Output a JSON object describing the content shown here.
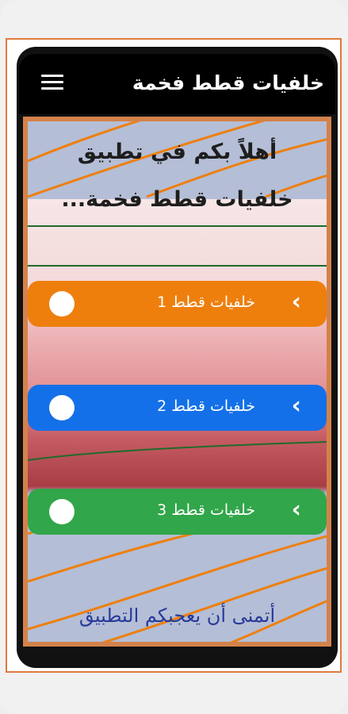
{
  "app_bar": {
    "title": "خلفيات قطط فخمة",
    "menu_icon": "hamburger-menu-icon"
  },
  "welcome": {
    "line1": "أهلاً بكم في تطبيق",
    "line2": "خلفيات قطط فخمة..."
  },
  "items": [
    {
      "label": "خلفيات قطط 1",
      "color": "#ee7f0d"
    },
    {
      "label": "خلفيات قطط 2",
      "color": "#1470e8"
    },
    {
      "label": "خلفيات قطط 3",
      "color": "#31a64a"
    }
  ],
  "footer": {
    "text": "أتمنى أن يعجبكم التطبيق"
  },
  "colors": {
    "frame_border": "#e07a3c",
    "app_bar_bg": "#000000",
    "content_border": "#d4824a",
    "stripe": "#ee7f0d",
    "footer_text": "#283a9a"
  }
}
